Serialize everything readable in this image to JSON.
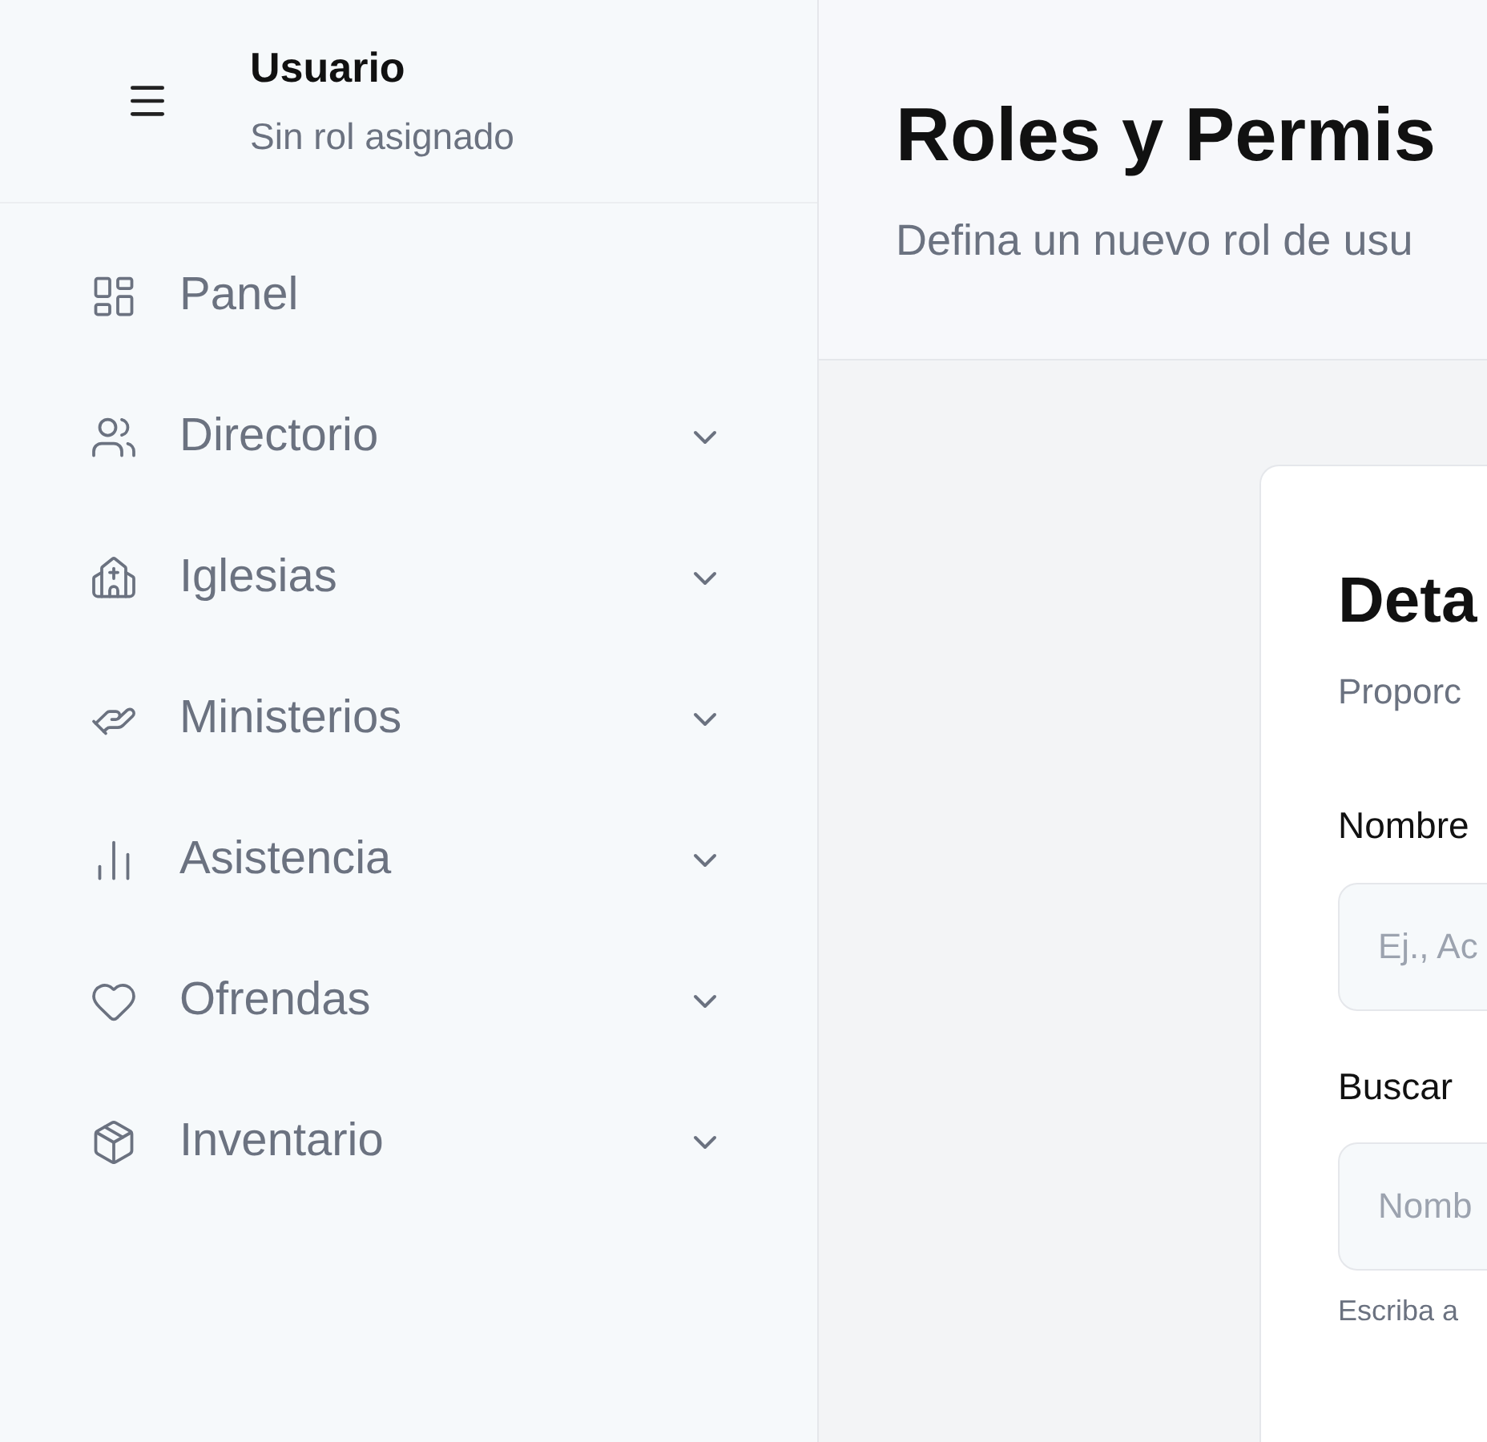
{
  "user": {
    "name": "Usuario",
    "role": "Sin rol asignado"
  },
  "nav": [
    {
      "label": "Panel",
      "kind": "link"
    },
    {
      "label": "Directorio",
      "kind": "group"
    },
    {
      "label": "Iglesias",
      "kind": "group"
    },
    {
      "label": "Ministerios",
      "kind": "group"
    },
    {
      "label": "Asistencia",
      "kind": "group"
    },
    {
      "label": "Ofrendas",
      "kind": "group"
    },
    {
      "label": "Inventario",
      "kind": "group"
    }
  ],
  "header": {
    "title": "Roles y Permis",
    "subtitle": "Defina un nuevo rol de usu"
  },
  "card": {
    "title": "Deta",
    "description": "Proporc",
    "fields": [
      {
        "label": "Nombre",
        "placeholder": "Ej., Ac"
      },
      {
        "label": "Buscar",
        "placeholder": "Nomb",
        "hint": "Escriba a"
      }
    ]
  }
}
